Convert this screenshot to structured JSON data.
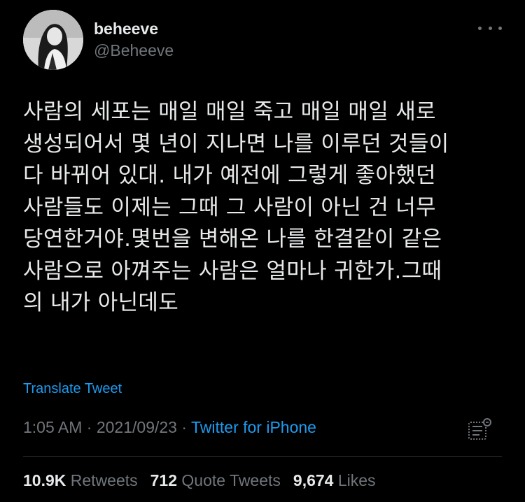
{
  "author": {
    "display_name": "beheeve",
    "handle": "@Beheeve"
  },
  "tweet": {
    "text": "사람의 세포는 매일 매일 죽고 매일 매일 새로\n생성되어서 몇 년이 지나면 나를 이루던 것들이\n다 바뀌어 있대. 내가 예전에 그렇게 좋아했던\n사람들도 이제는 그때 그 사람이 아닌 건 너무\n당연한거야.몇번을 변해온 나를 한결같이 같은\n사람으로 아껴주는 사람은 얼마나 귀한가.그때\n의 내가 아닌데도",
    "translate_label": "Translate Tweet"
  },
  "meta": {
    "time": "1:05 AM",
    "separator": " · ",
    "date": "2021/09/23",
    "source": "Twitter for iPhone"
  },
  "stats": {
    "retweets_count": "10.9K",
    "retweets_label": "Retweets",
    "quotes_count": "712",
    "quotes_label": "Quote Tweets",
    "likes_count": "9,674",
    "likes_label": "Likes"
  },
  "icons": {
    "more": "more-horizontal-icon",
    "analytics": "tweet-analytics-icon"
  },
  "colors": {
    "background": "#000000",
    "primary_text": "#e7e9ea",
    "secondary_text": "#71767b",
    "link": "#1d9bf0",
    "divider": "#2f3336"
  }
}
